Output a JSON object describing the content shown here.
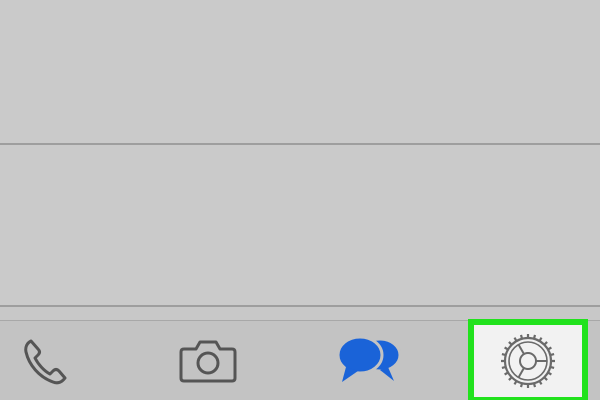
{
  "list": {
    "rows": [
      {
        "name": "empty-row-1"
      },
      {
        "name": "empty-row-2"
      }
    ]
  },
  "tab_bar": {
    "tabs": [
      {
        "id": "calls",
        "icon": "phone-icon",
        "state": "inactive"
      },
      {
        "id": "camera",
        "icon": "camera-icon",
        "state": "inactive"
      },
      {
        "id": "chats",
        "icon": "chat-bubbles-icon",
        "state": "active"
      },
      {
        "id": "settings",
        "icon": "gear-icon",
        "state": "highlighted"
      }
    ]
  },
  "colors": {
    "background": "#c8c8c8",
    "separator": "#9e9e9e",
    "icon_inactive": "#555555",
    "icon_active": "#1a63d8",
    "highlight": "#21e21d",
    "settings_tab_bg": "#f2f2f2"
  }
}
